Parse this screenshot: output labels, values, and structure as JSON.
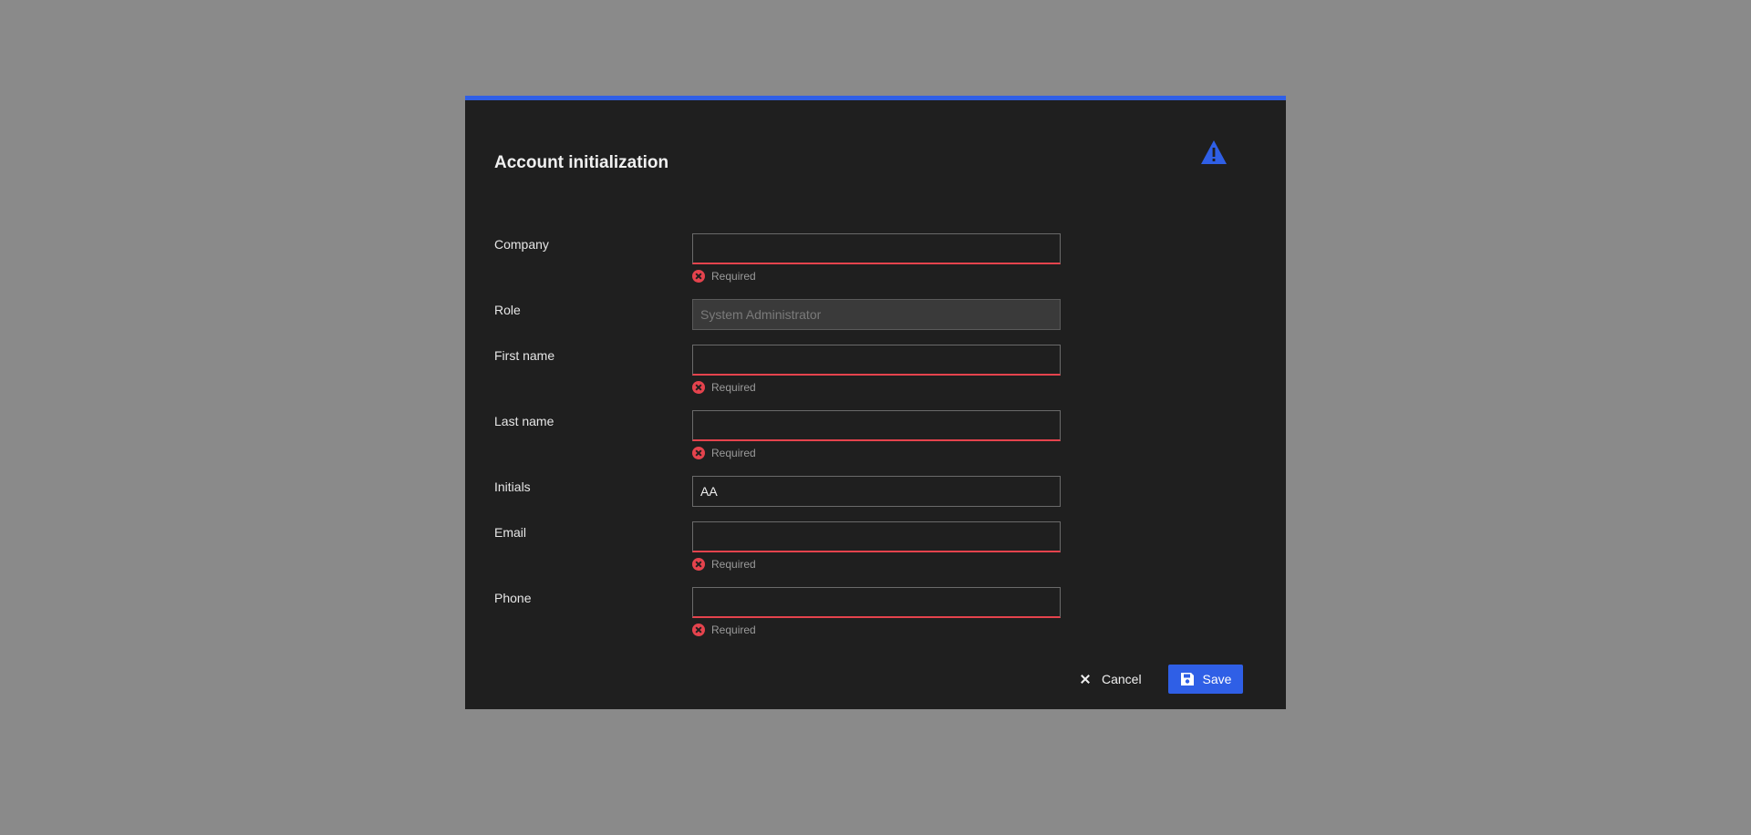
{
  "dialog": {
    "title": "Account initialization",
    "accent_color": "#2f5fe6",
    "warning_icon": "warning-triangle-icon"
  },
  "fields": {
    "company": {
      "label": "Company",
      "value": "",
      "error": "Required"
    },
    "role": {
      "label": "Role",
      "value": "",
      "placeholder": "System Administrator"
    },
    "first_name": {
      "label": "First name",
      "value": "",
      "error": "Required"
    },
    "last_name": {
      "label": "Last name",
      "value": "",
      "error": "Required"
    },
    "initials": {
      "label": "Initials",
      "value": "AA"
    },
    "email": {
      "label": "Email",
      "value": "",
      "error": "Required"
    },
    "phone": {
      "label": "Phone",
      "value": "",
      "error": "Required"
    }
  },
  "actions": {
    "cancel_label": "Cancel",
    "save_label": "Save"
  },
  "colors": {
    "overlay": "#8a8a8a",
    "dialog_bg": "#1f1f1f",
    "error": "#e5434d",
    "primary": "#2f5fe6"
  }
}
